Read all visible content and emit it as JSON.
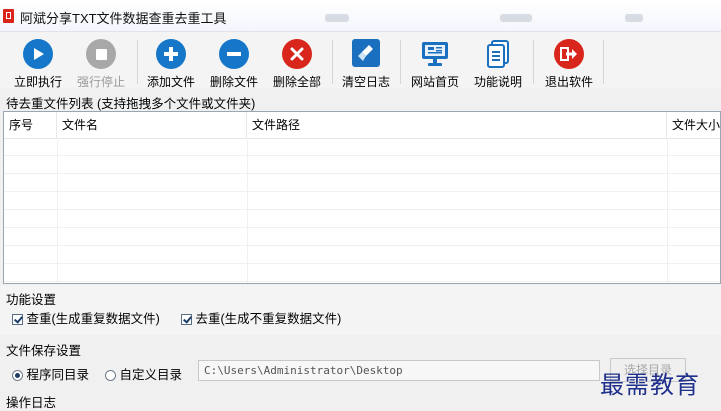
{
  "window": {
    "title": "阿斌分享TXT文件数据查重去重工具"
  },
  "toolbar": {
    "buttons": [
      {
        "label": "立即执行",
        "icon": "play-icon",
        "enabled": true
      },
      {
        "label": "强行停止",
        "icon": "stop-icon",
        "enabled": false
      },
      {
        "label": "添加文件",
        "icon": "plus-icon",
        "enabled": true
      },
      {
        "label": "删除文件",
        "icon": "minus-icon",
        "enabled": true
      },
      {
        "label": "删除全部",
        "icon": "close-icon",
        "enabled": true
      },
      {
        "label": "清空日志",
        "icon": "broom-icon",
        "enabled": true
      },
      {
        "label": "网站首页",
        "icon": "monitor-icon",
        "enabled": true
      },
      {
        "label": "功能说明",
        "icon": "document-icon",
        "enabled": true
      },
      {
        "label": "退出软件",
        "icon": "exit-icon",
        "enabled": true
      }
    ]
  },
  "file_list": {
    "title": "待去重文件列表 (支持拖拽多个文件或文件夹)",
    "columns": [
      "序号",
      "文件名",
      "文件路径",
      "文件大小"
    ],
    "rows": []
  },
  "function_settings": {
    "title": "功能设置",
    "options": [
      {
        "label": "查重(生成重复数据文件)",
        "checked": true
      },
      {
        "label": "去重(生成不重复数据文件)",
        "checked": true
      }
    ]
  },
  "save_settings": {
    "title": "文件保存设置",
    "options": [
      {
        "label": "程序同目录",
        "selected": true
      },
      {
        "label": "自定义目录",
        "selected": false
      }
    ],
    "path_value": "C:\\Users\\Administrator\\Desktop",
    "browse_label": "选择目录"
  },
  "log": {
    "title": "操作日志"
  },
  "watermark": "最需教育",
  "colors": {
    "blue_icon": "#1677c9",
    "red_icon": "#d9261c",
    "gray_icon": "#a8a8a8",
    "accent_checkbox": "#1b3e6c"
  }
}
